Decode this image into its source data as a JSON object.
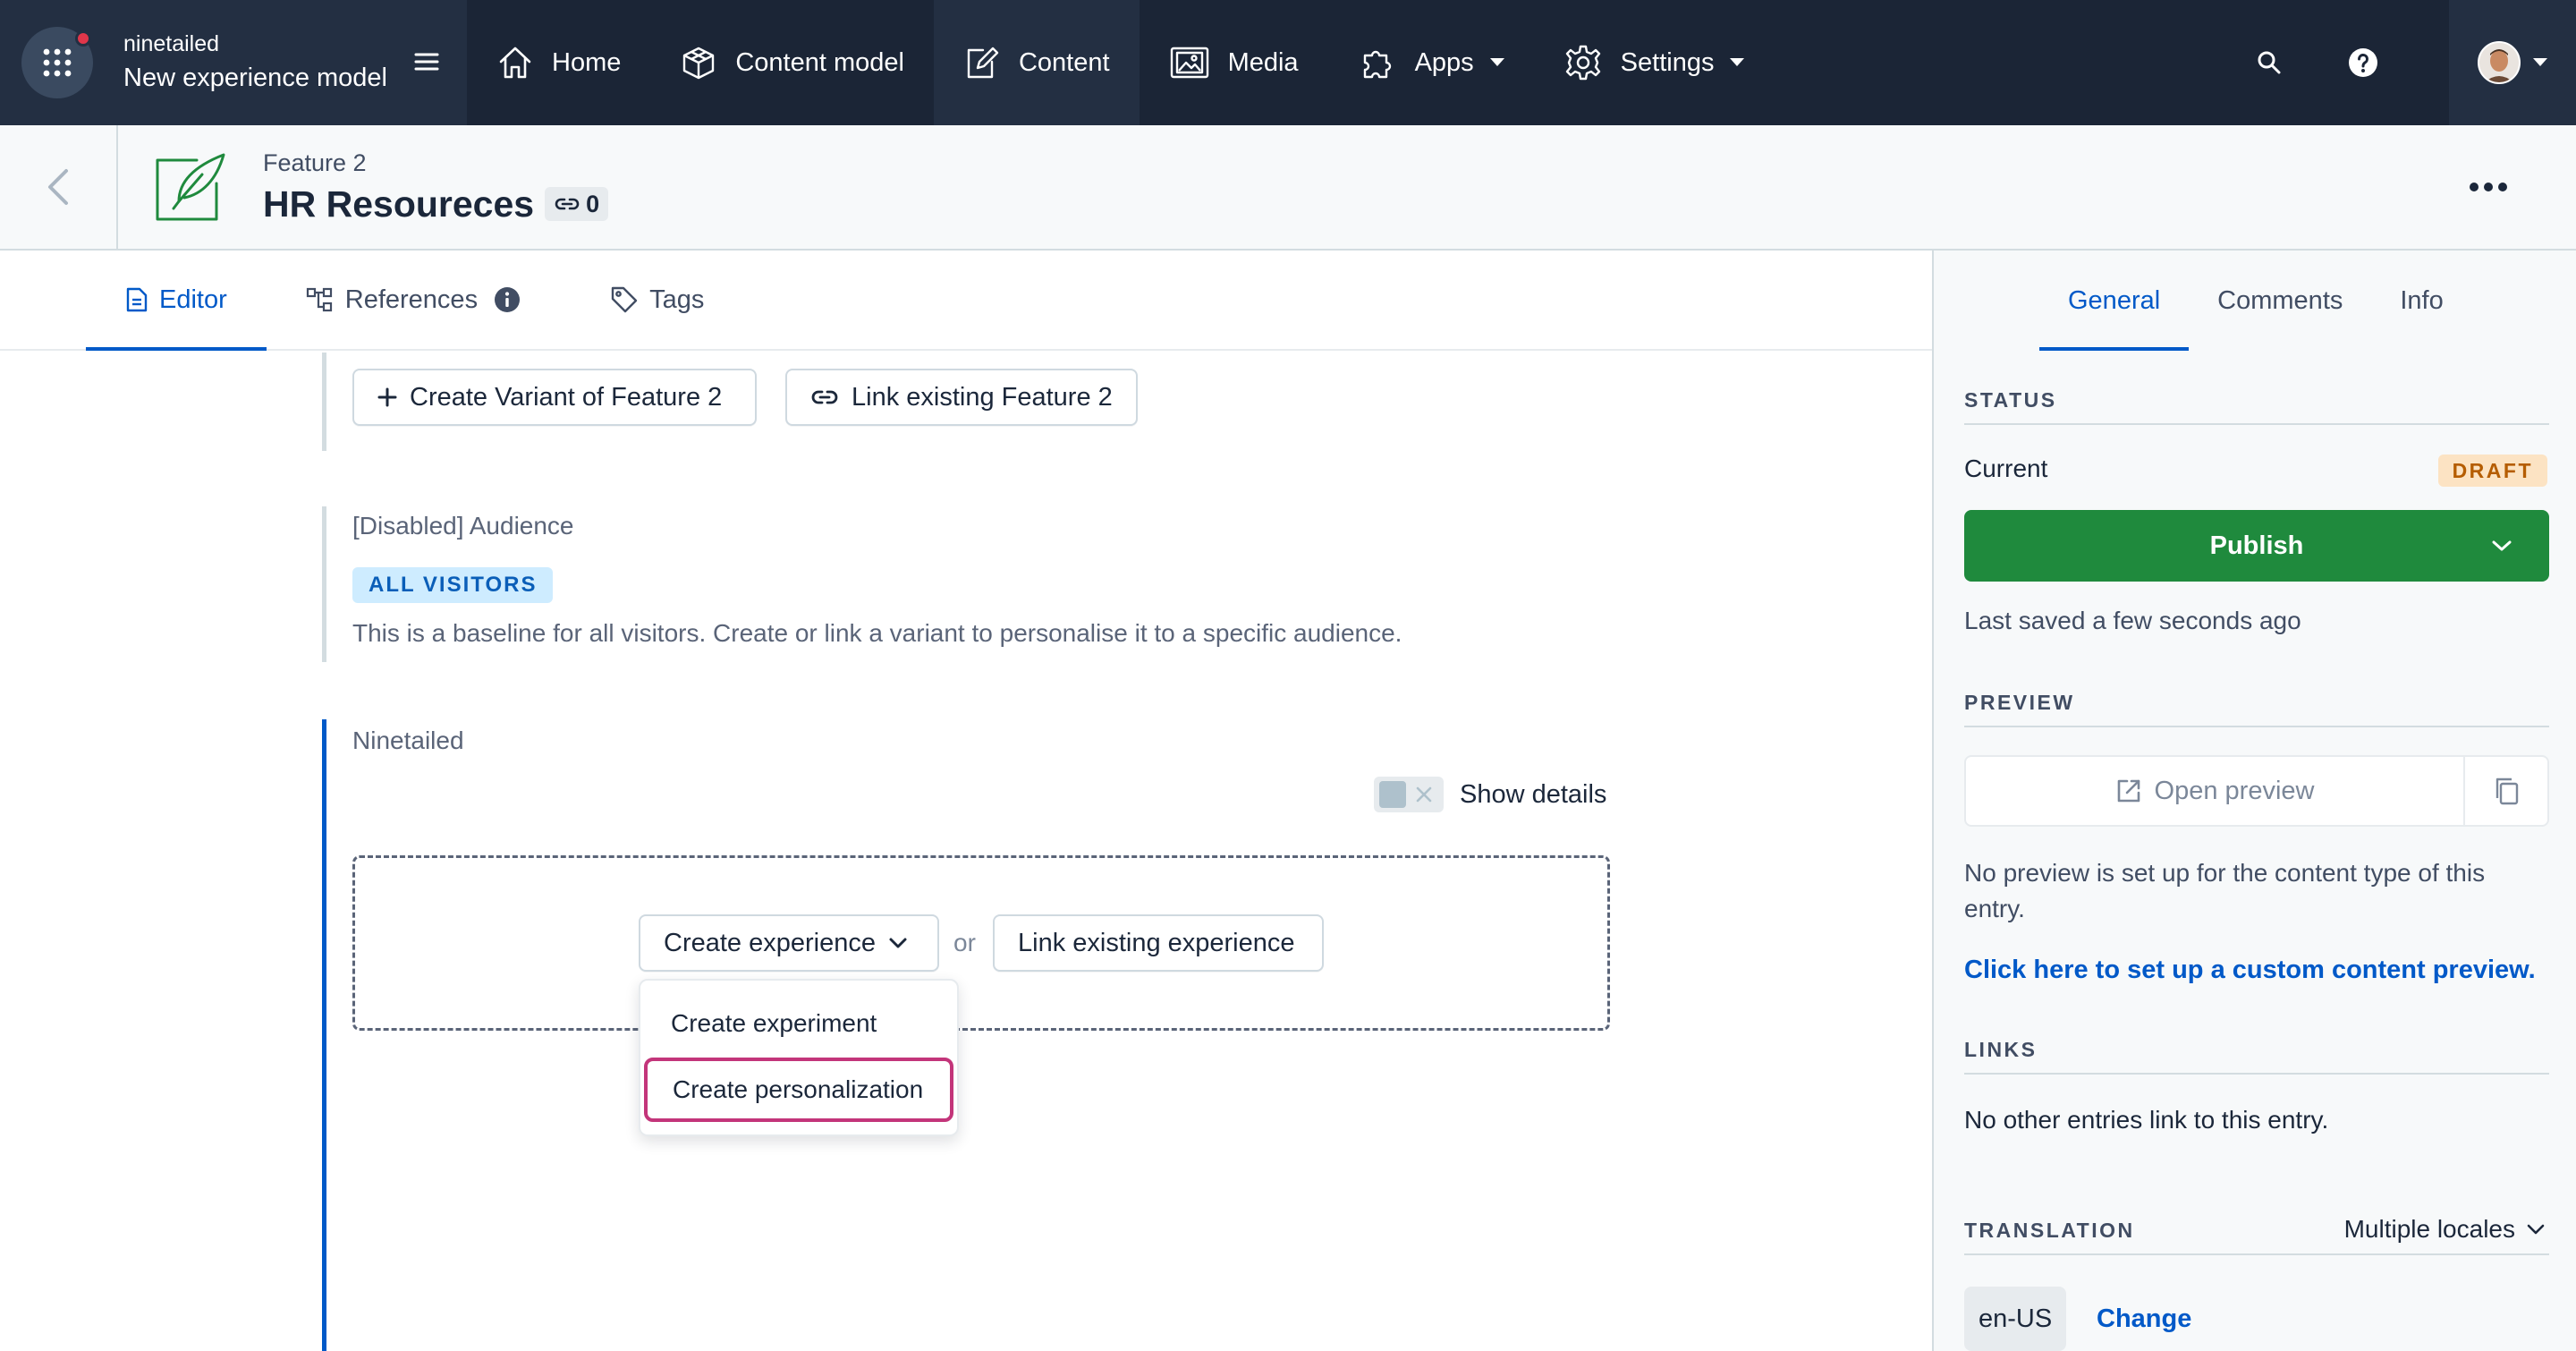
{
  "topnav": {
    "org": "ninetailed",
    "environment": "New experience model",
    "items": [
      {
        "label": "Home",
        "icon": "home-icon"
      },
      {
        "label": "Content model",
        "icon": "cube-icon"
      },
      {
        "label": "Content",
        "icon": "edit-icon"
      },
      {
        "label": "Media",
        "icon": "image-icon"
      },
      {
        "label": "Apps",
        "icon": "puzzle-icon"
      },
      {
        "label": "Settings",
        "icon": "gear-icon"
      }
    ]
  },
  "entry": {
    "content_type": "Feature 2",
    "title": "HR Resoureces",
    "link_count": "0"
  },
  "tabs": {
    "editor": "Editor",
    "references": "References",
    "tags": "Tags"
  },
  "editor": {
    "create_variant": "Create Variant of Feature 2",
    "link_existing_feature": "Link existing Feature 2",
    "audience_label": "[Disabled] Audience",
    "audience_pill": "ALL VISITORS",
    "audience_help": "This is a baseline for all visitors. Create or link a variant to personalise it to a specific audience.",
    "ninetailed_label": "Ninetailed",
    "show_details": "Show details",
    "create_experience": "Create experience",
    "or": "or",
    "link_existing_experience": "Link existing experience",
    "menu": [
      "Create experiment",
      "Create personalization"
    ]
  },
  "sidebar": {
    "tabs": [
      "General",
      "Comments",
      "Info"
    ],
    "status_title": "STATUS",
    "current_label": "Current",
    "status_badge": "DRAFT",
    "publish": "Publish",
    "last_saved": "Last saved a few seconds ago",
    "preview_title": "PREVIEW",
    "open_preview": "Open preview",
    "no_preview_line1": "No preview is set up for the content type of this",
    "no_preview_line2": "entry.",
    "setup_preview_link": "Click here to set up a custom content preview.",
    "links_title": "LINKS",
    "no_links": "No other entries link to this entry.",
    "translation_title": "TRANSLATION",
    "locales_select": "Multiple locales",
    "locale": "en-US",
    "change": "Change"
  },
  "colors": {
    "nav_bg": "#1b2536",
    "primary_blue": "#0059c8",
    "publish_green": "#1f8a3d",
    "focus_ring": "#c3357a",
    "draft_badge_bg": "#fce3c3"
  }
}
